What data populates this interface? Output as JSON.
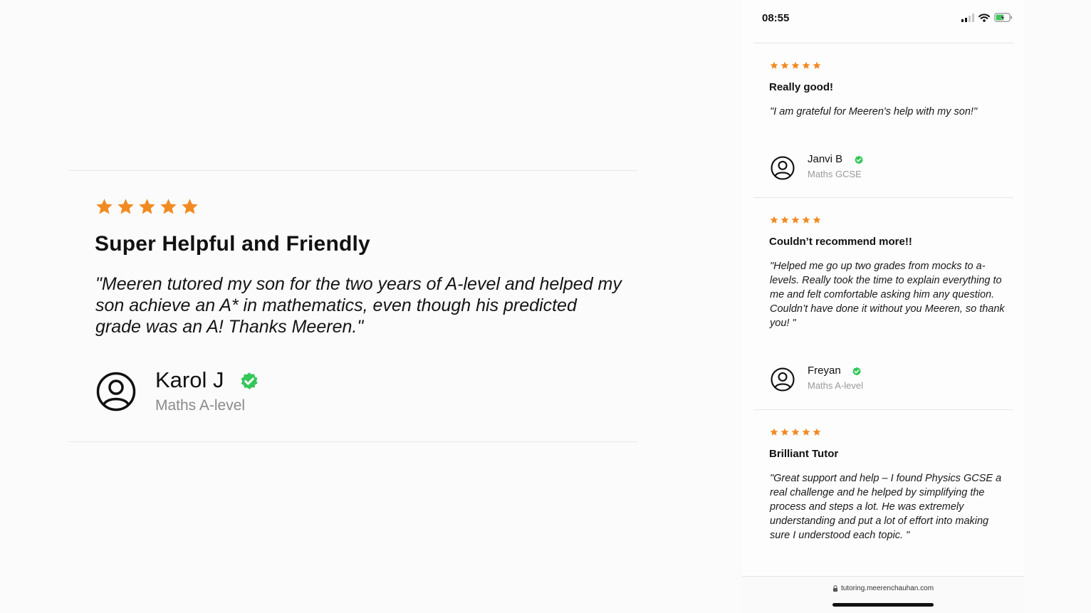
{
  "colors": {
    "star": "#f28a22",
    "verified": "#34c759",
    "text": "#111111",
    "muted": "#8a8a8a"
  },
  "featured_review": {
    "rating": 5,
    "title": "Super Helpful and Friendly",
    "quote": "\"Meeren tutored my son for the two years of A-level and helped my son achieve an A* in mathematics, even though his predicted grade was an A! Thanks Meeren.\"",
    "reviewer": "Karol J",
    "course": "Maths A-level",
    "icons": [
      "star-icon",
      "user-avatar-icon",
      "verified-badge-icon"
    ]
  },
  "phone": {
    "status_bar": {
      "time": "08:55",
      "icons": [
        "signal-icon",
        "wifi-icon",
        "battery-charging-icon"
      ]
    },
    "reviews": [
      {
        "rating": 5,
        "title": "Really good!",
        "quote": "\"I am grateful for Meeren's help with my son!\"",
        "reviewer": "Janvi B",
        "course": "Maths GCSE"
      },
      {
        "rating": 5,
        "title": "Couldn’t recommend more!!",
        "quote": "\"Helped me go up two grades from mocks to a-levels. Really took the time to explain everything to me and felt comfortable asking him any question. Couldn’t have done it without you Meeren, so thank you! \"",
        "reviewer": "Freyan",
        "course": "Maths A-level"
      },
      {
        "rating": 5,
        "title": "Brilliant Tutor",
        "quote": "\"Great support and help – I found Physics GCSE a real challenge and he helped by simplifying the process and steps a lot. He was extremely understanding and put a lot of effort into making sure I understood each topic. \""
      }
    ],
    "url_bar": {
      "url": "tutoring.meerenchauhan.com",
      "icon": "lock-icon"
    }
  }
}
